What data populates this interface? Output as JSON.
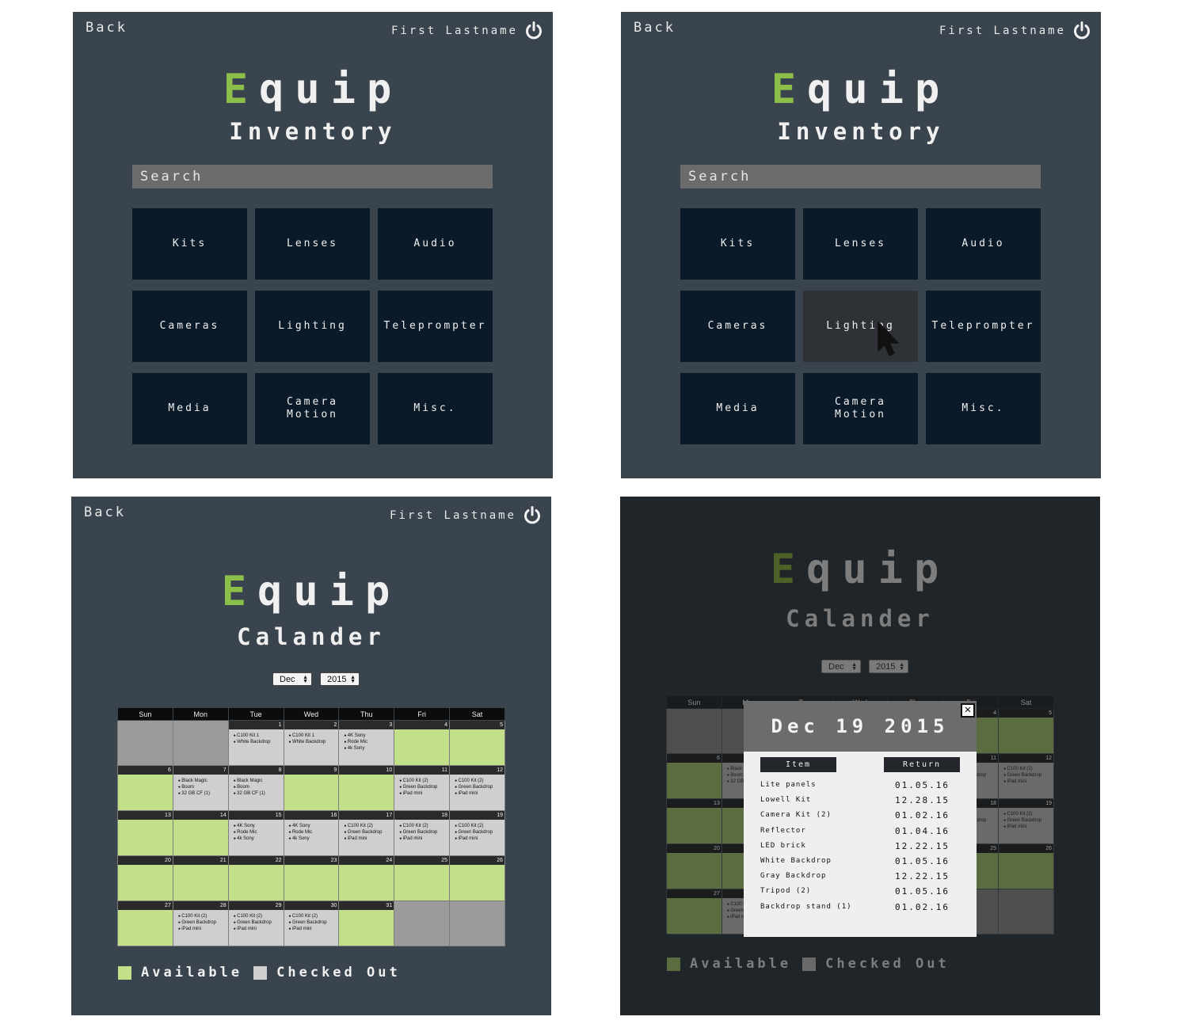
{
  "common": {
    "back_label": "Back",
    "user_name": "First Lastname",
    "logo_first": "E",
    "logo_rest": "quip"
  },
  "inventory": {
    "subtitle": "Inventory",
    "search_placeholder": "Search",
    "categories": [
      "Kits",
      "Lenses",
      "Audio",
      "Cameras",
      "Lighting",
      "Teleprompter",
      "Media",
      "Camera\nMotion",
      "Misc."
    ],
    "hovered_category": "Lighting"
  },
  "calendar": {
    "subtitle": "Calander",
    "month": "Dec",
    "year": "2015",
    "weekdays": [
      "Sun",
      "Mon",
      "Tue",
      "Wed",
      "Thu",
      "Fri",
      "Sat"
    ],
    "weeks": [
      [
        {
          "day": "",
          "status": "blank",
          "items": []
        },
        {
          "day": "",
          "status": "blank",
          "items": []
        },
        {
          "day": "1",
          "status": "checked",
          "items": [
            "C100 Kit 1",
            "White Backdrop"
          ]
        },
        {
          "day": "2",
          "status": "checked",
          "items": [
            "C100 Kit 1",
            "White Backdrop"
          ]
        },
        {
          "day": "3",
          "status": "checked",
          "items": [
            "4K Sony",
            "Rode Mic",
            "4k Sony"
          ]
        },
        {
          "day": "4",
          "status": "available",
          "items": []
        },
        {
          "day": "5",
          "status": "available",
          "items": []
        }
      ],
      [
        {
          "day": "6",
          "status": "available",
          "items": []
        },
        {
          "day": "7",
          "status": "checked",
          "items": [
            "Black Magic",
            "Boom",
            "32 GB CF (1)"
          ]
        },
        {
          "day": "8",
          "status": "checked",
          "items": [
            "Black Magic",
            "Boom",
            "32 GB CF (1)"
          ]
        },
        {
          "day": "9",
          "status": "available",
          "items": []
        },
        {
          "day": "10",
          "status": "available",
          "items": []
        },
        {
          "day": "11",
          "status": "checked",
          "items": [
            "C100 Kit (2)",
            "Green Backdrop",
            "iPad mini"
          ]
        },
        {
          "day": "12",
          "status": "checked",
          "items": [
            "C100 Kit (2)",
            "Green Backdrop",
            "iPad mini"
          ]
        }
      ],
      [
        {
          "day": "13",
          "status": "available",
          "items": []
        },
        {
          "day": "14",
          "status": "available",
          "items": []
        },
        {
          "day": "15",
          "status": "checked",
          "items": [
            "4K Sony",
            "Rode Mic",
            "4k Sony"
          ]
        },
        {
          "day": "16",
          "status": "checked",
          "items": [
            "4K Sony",
            "Rode Mic",
            "4k Sony"
          ]
        },
        {
          "day": "17",
          "status": "checked",
          "items": [
            "C100 Kit (2)",
            "Green Backdrop",
            "iPad mini"
          ]
        },
        {
          "day": "18",
          "status": "checked",
          "items": [
            "C100 Kit (2)",
            "Green Backdrop",
            "iPad mini"
          ]
        },
        {
          "day": "19",
          "status": "checked",
          "items": [
            "C100 Kit (2)",
            "Green Backdrop",
            "iPad mini"
          ]
        }
      ],
      [
        {
          "day": "20",
          "status": "available",
          "items": []
        },
        {
          "day": "21",
          "status": "available",
          "items": []
        },
        {
          "day": "22",
          "status": "available",
          "items": []
        },
        {
          "day": "23",
          "status": "available",
          "items": []
        },
        {
          "day": "24",
          "status": "available",
          "items": []
        },
        {
          "day": "25",
          "status": "available",
          "items": []
        },
        {
          "day": "26",
          "status": "available",
          "items": []
        }
      ],
      [
        {
          "day": "27",
          "status": "available",
          "items": []
        },
        {
          "day": "28",
          "status": "checked",
          "items": [
            "C100 Kit (2)",
            "Green Backdrop",
            "iPad mini"
          ]
        },
        {
          "day": "29",
          "status": "checked",
          "items": [
            "C100 Kit (2)",
            "Green Backdrop",
            "iPad mini"
          ]
        },
        {
          "day": "30",
          "status": "checked",
          "items": [
            "C100 Kit (2)",
            "Green Backdrop",
            "iPad mini"
          ]
        },
        {
          "day": "31",
          "status": "available",
          "items": []
        },
        {
          "day": "",
          "status": "blank",
          "items": []
        },
        {
          "day": "",
          "status": "blank",
          "items": []
        }
      ]
    ],
    "legend": {
      "available_label": "Available",
      "checked_out_label": "Checked Out",
      "available_color": "#c2df8a",
      "checked_out_color": "#cfcfcf"
    }
  },
  "day_detail": {
    "title": "Dec 19 2015",
    "close_label": "✕",
    "col_item": "Item",
    "col_return": "Return",
    "rows": [
      {
        "item": "Lite panels",
        "return": "01.05.16"
      },
      {
        "item": "Lowell Kit",
        "return": "12.28.15"
      },
      {
        "item": "Camera Kit (2)",
        "return": "01.02.16"
      },
      {
        "item": "Reflector",
        "return": "01.04.16"
      },
      {
        "item": "LED brick",
        "return": "12.22.15"
      },
      {
        "item": "White Backdrop",
        "return": "01.05.16"
      },
      {
        "item": "Gray Backdrop",
        "return": "12.22.15"
      },
      {
        "item": "Tripod (2)",
        "return": "01.05.16"
      },
      {
        "item": "Backdrop stand (1)",
        "return": "01.02.16"
      }
    ]
  },
  "colors": {
    "panel_bg": "#3a444e",
    "tile_bg": "#0a1a28",
    "accent_green": "#8cbf4a"
  },
  "icons": {
    "power": "power-icon",
    "cursor": "mouse-pointer-icon",
    "select_arrows": "updown-arrows-icon",
    "close": "close-icon"
  }
}
